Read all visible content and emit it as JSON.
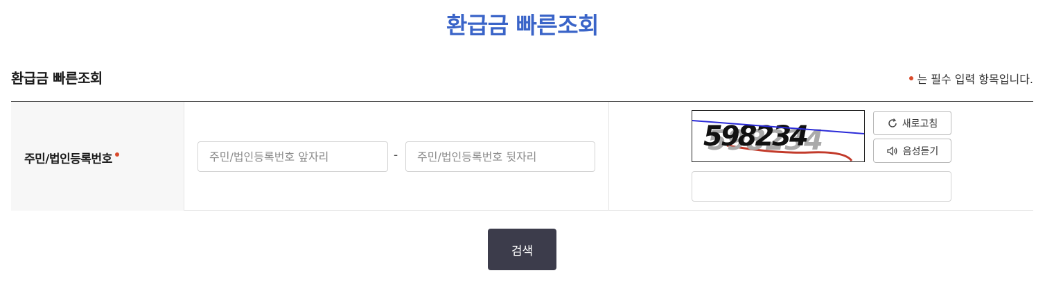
{
  "page": {
    "title": "환급금 빠른조회"
  },
  "section": {
    "title": "환급금 빠른조회",
    "required_note": "는 필수 입력 항목입니다."
  },
  "form": {
    "id_label": "주민/법인등록번호",
    "front": {
      "placeholder": "주민/법인등록번호 앞자리",
      "value": ""
    },
    "separator": "-",
    "back": {
      "placeholder": "주민/법인등록번호 뒷자리",
      "value": ""
    },
    "captcha": {
      "text": "598234",
      "refresh_label": "새로고침",
      "audio_label": "음성듣기",
      "input_value": "",
      "refresh_icon": "refresh-icon",
      "audio_icon": "speaker-icon"
    }
  },
  "actions": {
    "search_label": "검색"
  },
  "colors": {
    "title": "#3a64c8",
    "required_dot": "#d94a2b",
    "search_button": "#3c3c4b"
  }
}
